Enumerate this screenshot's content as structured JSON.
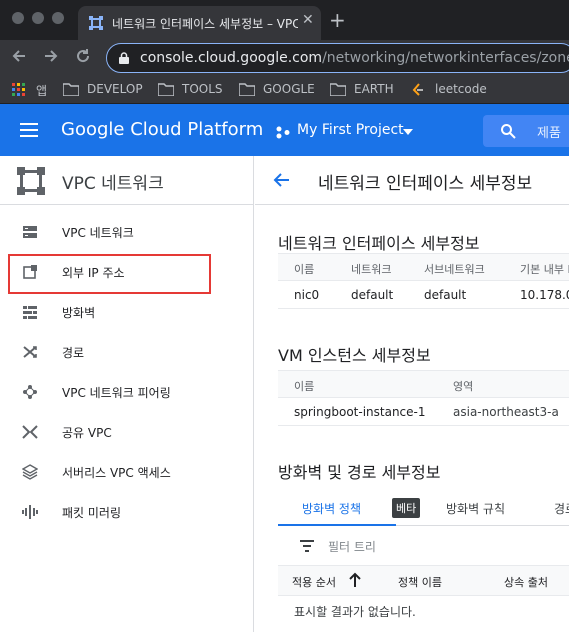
{
  "browser": {
    "tab_title": "네트워크 인터페이스 세부정보 – VPC",
    "tab_close": "✕",
    "new_tab": "+",
    "url_host": "console.cloud.google.com",
    "url_path": "/networking/networkinterfaces/zones/a",
    "bookmarks": [
      "앱",
      "DEVELOP",
      "TOOLS",
      "GOOGLE",
      "EARTH",
      "leetcode"
    ]
  },
  "header": {
    "logo": "Google Cloud Platform",
    "project": "My First Project",
    "search_placeholder": "제품"
  },
  "sidebar": {
    "title": "VPC 네트워크",
    "items": [
      {
        "label": "VPC 네트워크",
        "icon": "vpc-network-icon"
      },
      {
        "label": "외부 IP 주소",
        "icon": "external-ip-icon"
      },
      {
        "label": "방화벽",
        "icon": "firewall-icon"
      },
      {
        "label": "경로",
        "icon": "routes-icon"
      },
      {
        "label": "VPC 네트워크 피어링",
        "icon": "peering-icon"
      },
      {
        "label": "공유 VPC",
        "icon": "shared-vpc-icon"
      },
      {
        "label": "서버리스 VPC 액세스",
        "icon": "serverless-icon"
      },
      {
        "label": "패킷 미러링",
        "icon": "packet-mirroring-icon"
      }
    ]
  },
  "main": {
    "page_title": "네트워크 인터페이스 세부정보",
    "nic_section": {
      "title": "네트워크 인터페이스 세부정보",
      "headers": [
        "이름",
        "네트워크",
        "서브네트워크",
        "기본 내부 I"
      ],
      "row": [
        "nic0",
        "default",
        "default",
        "10.178.0"
      ]
    },
    "vm_section": {
      "title": "VM 인스턴스 세부정보",
      "headers": [
        "이름",
        "영역"
      ],
      "row": [
        "springboot-instance-1",
        "asia-northeast3-a"
      ]
    },
    "fw_section": {
      "title": "방화벽 및 경로 세부정보",
      "tabs": [
        "방화벽 정책",
        "방화벽 규칙",
        "경로"
      ],
      "beta": "베타",
      "filter_placeholder": "필터 트리",
      "headers": [
        "적용 순서",
        "정책 이름",
        "상속 출처"
      ],
      "empty": "표시할 결과가 없습니다."
    }
  },
  "colors": {
    "brand_blue": "#1a73e8",
    "highlight_red": "#e53935"
  }
}
